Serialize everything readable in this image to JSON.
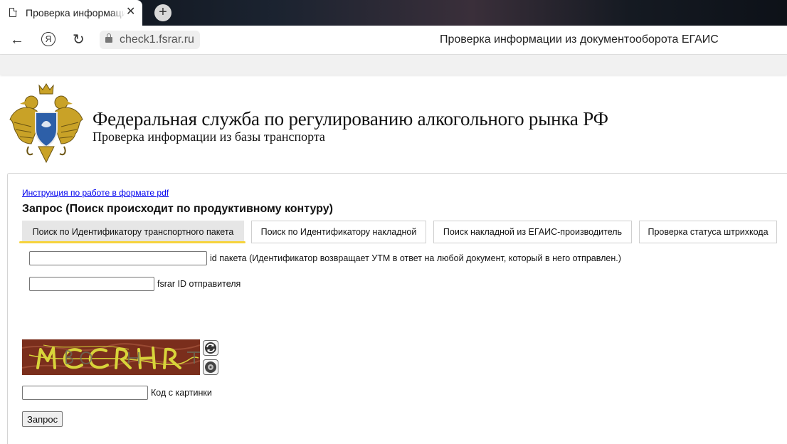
{
  "browser": {
    "tab_title": "Проверка информации из документооборота ЕГАИС",
    "tab_close": "✕",
    "new_tab": "+",
    "address": "check1.fsrar.ru",
    "page_heading": "Проверка информации из документооборота ЕГАИС",
    "back_glyph": "←",
    "reload_glyph": "↻",
    "yandex_glyph": "Я"
  },
  "header": {
    "title": "Федеральная служба по регулированию алкогольного рынка РФ",
    "subtitle": "Проверка информации из базы транспорта"
  },
  "content": {
    "pdf_link": "Инструкция по работе в формате pdf",
    "query_title": "Запрос (Поиск происходит по продуктивному контуру)",
    "tabs": [
      {
        "label": "Поиск по Идентификатору транспортного пакета",
        "active": true
      },
      {
        "label": "Поиск по Идентификатору накладной",
        "active": false
      },
      {
        "label": "Поиск накладной из ЕГАИС-производитель",
        "active": false
      },
      {
        "label": "Проверка статуса штрихкода",
        "active": false
      }
    ],
    "fields": {
      "package_id_label": "id пакета (Идентификатор возвращает УТМ в ответ на любой документ, который в него отправлен.)",
      "package_id_value": "",
      "sender_id_label": "fsrar ID отправителя",
      "sender_id_value": "",
      "captcha_label": "Код с картинки",
      "captcha_value": ""
    },
    "submit_label": "Запрос"
  },
  "colors": {
    "active_tab_bg": "#e6e6e6",
    "tab_underline": "#f6d33c",
    "link": "#0000ee",
    "captcha_bg": "#7a2e1c",
    "captcha_text": "#d8d43a"
  },
  "icons": {
    "emblem": "double-headed-eagle-emblem",
    "refresh": "refresh-icon",
    "audio": "speaker-icon"
  }
}
